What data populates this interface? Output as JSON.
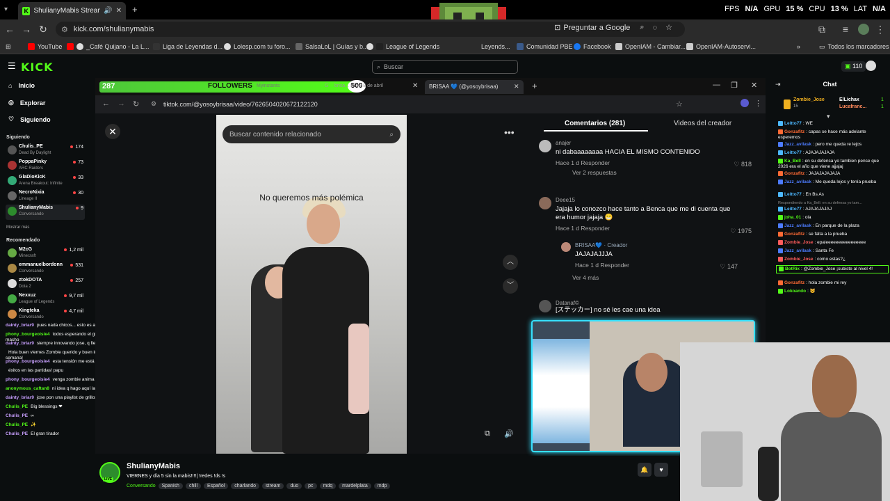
{
  "browser": {
    "tab_title": "ShulianyMabis Stream - W",
    "url": "kick.com/shulianymabis",
    "google_btn": "Preguntar a Google",
    "bookmarks": [
      "YouTube",
      "_Café Quijano - La L...",
      "Liga de Leyendas d...",
      "Lolesp.com tu foro...",
      "SalsaLoL | Guías y b...",
      "League of Legends",
      "Leyends...",
      "Comunidad PBE",
      "Facebook",
      "OpenIAM - Cambiar...",
      "OpenIAM-Autoservi..."
    ],
    "bookmarks_all": "Todos los marcadores"
  },
  "perf": {
    "fps_label": "FPS",
    "fps": "N/A",
    "gpu_label": "GPU",
    "gpu": "15 %",
    "cpu_label": "CPU",
    "cpu": "13 %",
    "lat_label": "LAT",
    "lat": "N/A"
  },
  "kick": {
    "search_placeholder": "Buscar",
    "points": "110"
  },
  "sidebar": {
    "nav": [
      "Inicio",
      "Explorar",
      "Siguiendo"
    ],
    "following_heading": "Siguiendo",
    "following": [
      {
        "name": "Chulis_PE",
        "game": "Dead By Daylight",
        "viewers": "174"
      },
      {
        "name": "PoppaPinky",
        "game": "ARC Raiders",
        "viewers": "73"
      },
      {
        "name": "GlaDioKicK",
        "game": "Arena Breakout: Infinite",
        "viewers": "33"
      },
      {
        "name": "NecroNixia",
        "game": "Lineage II",
        "viewers": "30"
      },
      {
        "name": "ShulianyMabis",
        "game": "Conversando",
        "viewers": "9"
      }
    ],
    "show_more": "Mostrar más",
    "recommended_heading": "Recomendado",
    "recommended": [
      {
        "name": "M2cG",
        "game": "Minecraft",
        "viewers": "1,2 mil"
      },
      {
        "name": "emmanuelbordonn",
        "game": "Conversando",
        "viewers": "531"
      },
      {
        "name": "ztokDOTA",
        "game": "Dota 2",
        "viewers": "257"
      },
      {
        "name": "Nexxuz",
        "game": "League of Legends",
        "viewers": "9,7 mil"
      },
      {
        "name": "Kingteka",
        "game": "Conversando",
        "viewers": "4,7 mil"
      }
    ]
  },
  "overlay_chat": [
    {
      "user": "dainty_briar9",
      "msg": "pues nada chicos... esto es arte abstracto"
    },
    {
      "user": "phony_bourgeoisie4",
      "msg": "todos esperando el giro inesperado macho"
    },
    {
      "user": "dainty_briar9",
      "msg": "siempre innovando jose, q fiera macho"
    },
    {
      "user": "",
      "msg": "Hola buen viernes Zombie querido y buen inicio de fin de semana!"
    },
    {
      "user": "phony_bourgeoisie4",
      "msg": "esta tensión me está matando tio"
    },
    {
      "user": "",
      "msg": "éxitos en las partidas! papu"
    },
    {
      "user": "phony_bourgeoisie4",
      "msg": "venga zombie anima el cotarro ya"
    },
    {
      "user": "anonymous_caftan8",
      "msg": "ni idea q hago aquí la verdad"
    },
    {
      "user": "dainty_briar9",
      "msg": "jose pon una playlist de grillos bro"
    },
    {
      "user": "Chulis_PE",
      "msg": "Big blessings ❤"
    },
    {
      "user": "Chulis_PE",
      "msg": "∞"
    },
    {
      "user": "Chulis_PE",
      "msg": "✨"
    },
    {
      "user": "Chulis_PE",
      "msg": "El gran tirador"
    }
  ],
  "followers_goal": {
    "count": "287",
    "label": "FOLLOWERS",
    "goal": "500"
  },
  "inner_browser": {
    "tabs": [
      "Myinstants",
      "brisa... show 8 de abril",
      "BRISAA 💙 (@yosoybrisaa)"
    ],
    "url": "tiktok.com/@yosoybrisaa/video/7626504020672122120"
  },
  "tiktok": {
    "search_placeholder": "Buscar contenido relacionado",
    "caption": "No queremos más polémica",
    "tabs": [
      "Comentarios (281)",
      "Videos del creador"
    ],
    "comments": [
      {
        "user": "anajer",
        "text": "ni dabaaaaaaaa HACIA EL MISMO CONTENIDO",
        "meta": "Hace 1 d   Responder",
        "likes": "818",
        "replies": "Ver 2 respuestas"
      },
      {
        "user": "Deee15",
        "text": "Jajaja lo conozco hace tanto a Benca que me di cuenta que era humor jajaja 😁",
        "meta": "Hace 1 d   Responder",
        "likes": "1975"
      },
      {
        "user": "BRISAA💙 · Creador",
        "text": "JAJAJAJJJA",
        "meta": "Hace 1 d   Responder",
        "likes": "147",
        "replies": "Ver 4 más"
      },
      {
        "user": "Datanaf©",
        "text": "[ステッカー] no sé les cae una idea",
        "meta": "",
        "likes": ""
      }
    ]
  },
  "chat": {
    "title": "Chat",
    "top": [
      {
        "user": "Zombie_Jose",
        "sub": "15"
      },
      {
        "user": "ElLichax",
        "sub": "1"
      },
      {
        "user": "Lucafranc...",
        "sub": "1"
      }
    ],
    "messages": [
      {
        "user": "Leitto77",
        "msg": "WE",
        "color": "#4db8ff"
      },
      {
        "user": "Gonzafitz",
        "msg": "capas se hace más adelante esperemos",
        "color": "#ff6b35"
      },
      {
        "user": "Jazz_avilask",
        "msg": "pero me queda re lejos",
        "color": "#4d7cff"
      },
      {
        "user": "Leitto77",
        "msg": "AJAJAJAJAJA",
        "color": "#4db8ff"
      },
      {
        "user": "Ka_Bell",
        "msg": "en su defensa yo tambien pense que 2026 era el año que viene ajjajaj",
        "color": "#53fc18"
      },
      {
        "user": "Gonzafitz",
        "msg": "JAJAJAJAJAJA",
        "color": "#ff6b35"
      },
      {
        "user": "Jazz_avilask",
        "msg": "Me queda lejos y tenía prueba",
        "color": "#4d7cff"
      },
      {
        "user": "Leitto77",
        "msg": "En Bs As",
        "color": "#4db8ff"
      },
      {
        "user": "Leitto77",
        "msg": "AJAJAJAJAJ",
        "color": "#4db8ff"
      },
      {
        "user": "joha_01",
        "msg": "ola",
        "color": "#53fc18"
      },
      {
        "user": "Jazz_avilask",
        "msg": "En parque de la plaza",
        "color": "#4d7cff"
      },
      {
        "user": "Gonzafitz",
        "msg": "se falta a la prueba",
        "color": "#ff6b35"
      },
      {
        "user": "Zombie_Jose",
        "msg": "epaleeeeeeeeeeeeeeee",
        "color": "#ff5c5c"
      },
      {
        "user": "Jazz_avilask",
        "msg": "Santa Fe",
        "color": "#4d7cff"
      },
      {
        "user": "Zombie_Jose",
        "msg": "como estas?¿",
        "color": "#ff5c5c"
      },
      {
        "user": "BotRix",
        "msg": "@Zombie_Jose ¡subiste al nivel 4!",
        "color": "#53fc18"
      },
      {
        "user": "Gonzafitz",
        "msg": "hola zombie mi rey",
        "color": "#ff6b35"
      },
      {
        "user": "Lokoando",
        "msg": "😺",
        "color": "#53fc18"
      }
    ],
    "reply_hint": "Respondiendo a Ka_Bell: en su defensa yo tam..."
  },
  "stream": {
    "name": "ShulianyMabis",
    "title": "VIERNES y día 5 sin la mabis!!!!| !redes !ds !s",
    "category": "Conversando",
    "tags": [
      "Spanish",
      "chill",
      "Español",
      "charlando",
      "stream",
      "duo",
      "pc",
      "mdq",
      "mardelplata",
      "mdp"
    ],
    "live": "LIVE"
  },
  "colors": {
    "kick_green": "#53fc18",
    "accent_cyan": "#36e0ff"
  }
}
